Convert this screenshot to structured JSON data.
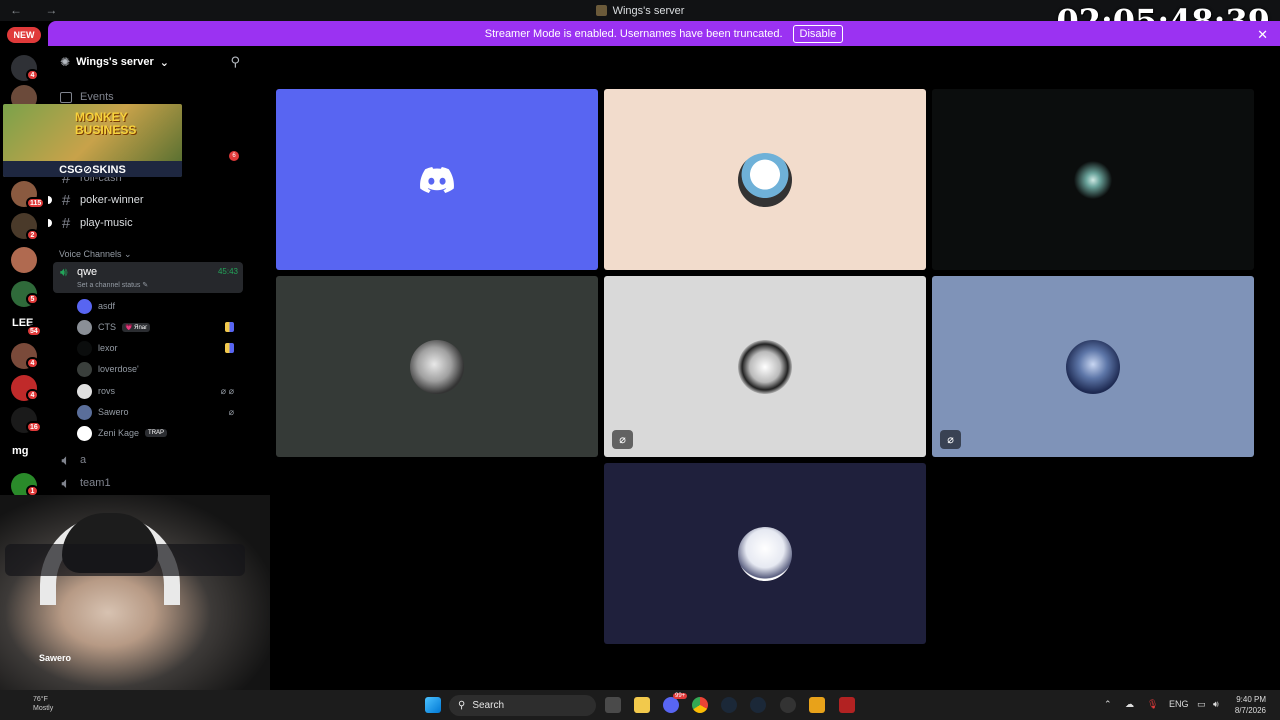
{
  "window": {
    "title": "Wings's server",
    "nav": "← →",
    "close": "✕"
  },
  "overlay_clock": "02:05:48:39",
  "banner": {
    "text": "Streamer Mode is enabled. Usernames have been truncated.",
    "button": "Disable"
  },
  "rail": {
    "new_label": "NEW",
    "badges": [
      "4",
      "115",
      "2",
      "5",
      "54",
      "4",
      "4",
      "16",
      "1"
    ],
    "text_icons": [
      "LEE",
      "mg"
    ]
  },
  "sidebar": {
    "server_name": "Wings's server",
    "events": "Events",
    "unread_count": "6",
    "channels": [
      {
        "name": "roll-cash"
      },
      {
        "name": "poker-winner"
      },
      {
        "name": "play-music"
      }
    ],
    "voice_category": "Voice Channels",
    "active_voice": {
      "name": "qwe",
      "time": "45:43",
      "status_placeholder": "Set a channel status"
    },
    "members": [
      {
        "name": "asdf",
        "tag": ""
      },
      {
        "name": "CTS",
        "tag": "💗 Яnaг"
      },
      {
        "name": "lexor",
        "tag": ""
      },
      {
        "name": "loverdose'",
        "tag": ""
      },
      {
        "name": "rovs",
        "tag": ""
      },
      {
        "name": "Sawero",
        "tag": ""
      },
      {
        "name": "Zeni Kage",
        "tag": "TRAP"
      }
    ],
    "other_voice": [
      {
        "name": "a"
      },
      {
        "name": "team1"
      }
    ]
  },
  "ad": {
    "title_line1": "MONKEY",
    "title_line2": "BUSINESS",
    "brand": "CSG⊘SKINS"
  },
  "webcam": {
    "name_tag": "Sawero"
  },
  "grid": {
    "tiles": [
      {
        "bg": "#5865f2",
        "kind": "discord-logo",
        "badge": ""
      },
      {
        "bg": "#f2dccc",
        "kind": "avatar",
        "badge": ""
      },
      {
        "bg": "#0b0d0d",
        "kind": "avatar",
        "badge": ""
      },
      {
        "bg": "#353a37",
        "kind": "avatar",
        "badge": ""
      },
      {
        "bg": "#d9d9d9",
        "kind": "avatar",
        "badge": "⌀"
      },
      {
        "bg": "#7f93b8",
        "kind": "avatar",
        "badge": "⌀"
      },
      {
        "bg": "#1f203c",
        "kind": "avatar",
        "badge": ""
      }
    ]
  },
  "taskbar": {
    "search_placeholder": "Search",
    "weather_temp": "76°F",
    "weather_desc": "Mostly",
    "lang": "ENG",
    "time": "9:40 PM",
    "date": "8/7/2026",
    "chat_badge": "99+"
  }
}
